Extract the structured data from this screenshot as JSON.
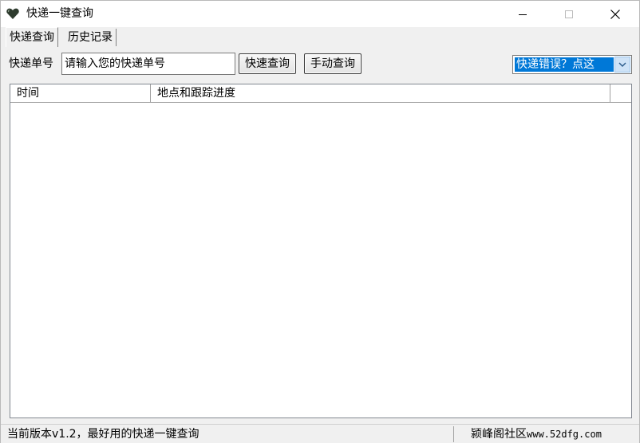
{
  "window": {
    "title": "快递一键查询",
    "icon": "heart-icon"
  },
  "tabs": [
    {
      "label": "快递查询",
      "active": true
    },
    {
      "label": "历史记录",
      "active": false
    }
  ],
  "query": {
    "label": "快递单号",
    "input_value": "请输入您的快递单号",
    "fast_button": "快速查询",
    "manual_button": "手动查询",
    "dropdown_value": "快递错误？点这"
  },
  "list": {
    "columns": [
      "时间",
      "地点和跟踪进度",
      ""
    ]
  },
  "status": {
    "left": "当前版本v1.2，最好用的快递一键查询",
    "right_name": "颍峰阁社区",
    "right_url": "www.52dfg.com"
  },
  "colors": {
    "selection": "#0078d7",
    "window_bg": "#f0f0f0"
  }
}
